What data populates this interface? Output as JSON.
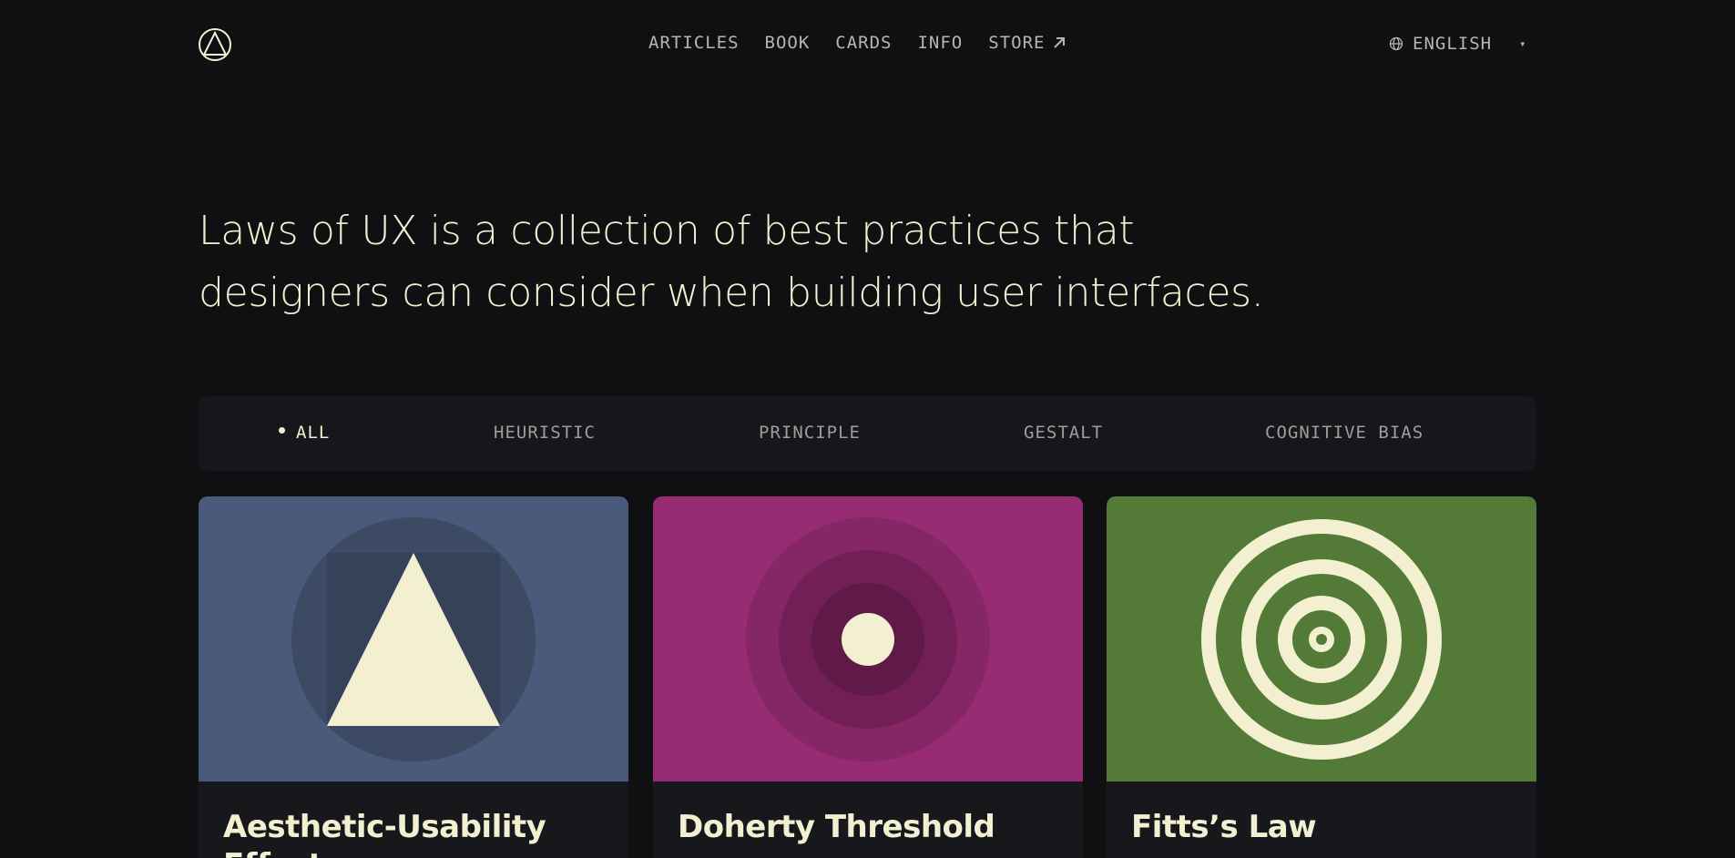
{
  "header": {
    "nav": [
      {
        "label": "ARTICLES"
      },
      {
        "label": "BOOK"
      },
      {
        "label": "CARDS"
      },
      {
        "label": "INFO"
      },
      {
        "label": "STORE",
        "icon": "arrow-up-right-icon"
      }
    ],
    "language": {
      "label": "ENGLISH",
      "icon": "globe-icon",
      "caret_icon": "caret-down-icon"
    },
    "logo_icon": "circle-triangle-logo-icon"
  },
  "hero": {
    "text": "Laws of UX is a collection of best practices that designers can consider when building user interfaces."
  },
  "filters": [
    {
      "label": "ALL",
      "active": true
    },
    {
      "label": "HEURISTIC",
      "active": false
    },
    {
      "label": "PRINCIPLE",
      "active": false
    },
    {
      "label": "GESTALT",
      "active": false
    },
    {
      "label": "COGNITIVE BIAS",
      "active": false
    }
  ],
  "cards": [
    {
      "title": "Aesthetic-Usability Effect",
      "color": "#4a5a7a",
      "icon": "triangle-in-circle-icon"
    },
    {
      "title": "Doherty Threshold",
      "color": "#982c74",
      "icon": "concentric-dot-icon"
    },
    {
      "title": "Fitts’s Law",
      "color": "#537a36",
      "icon": "target-rings-icon"
    }
  ],
  "colors": {
    "background": "#101013",
    "text": "#f2f0d0",
    "muted": "#b6b6b1",
    "panel": "#16171b"
  }
}
